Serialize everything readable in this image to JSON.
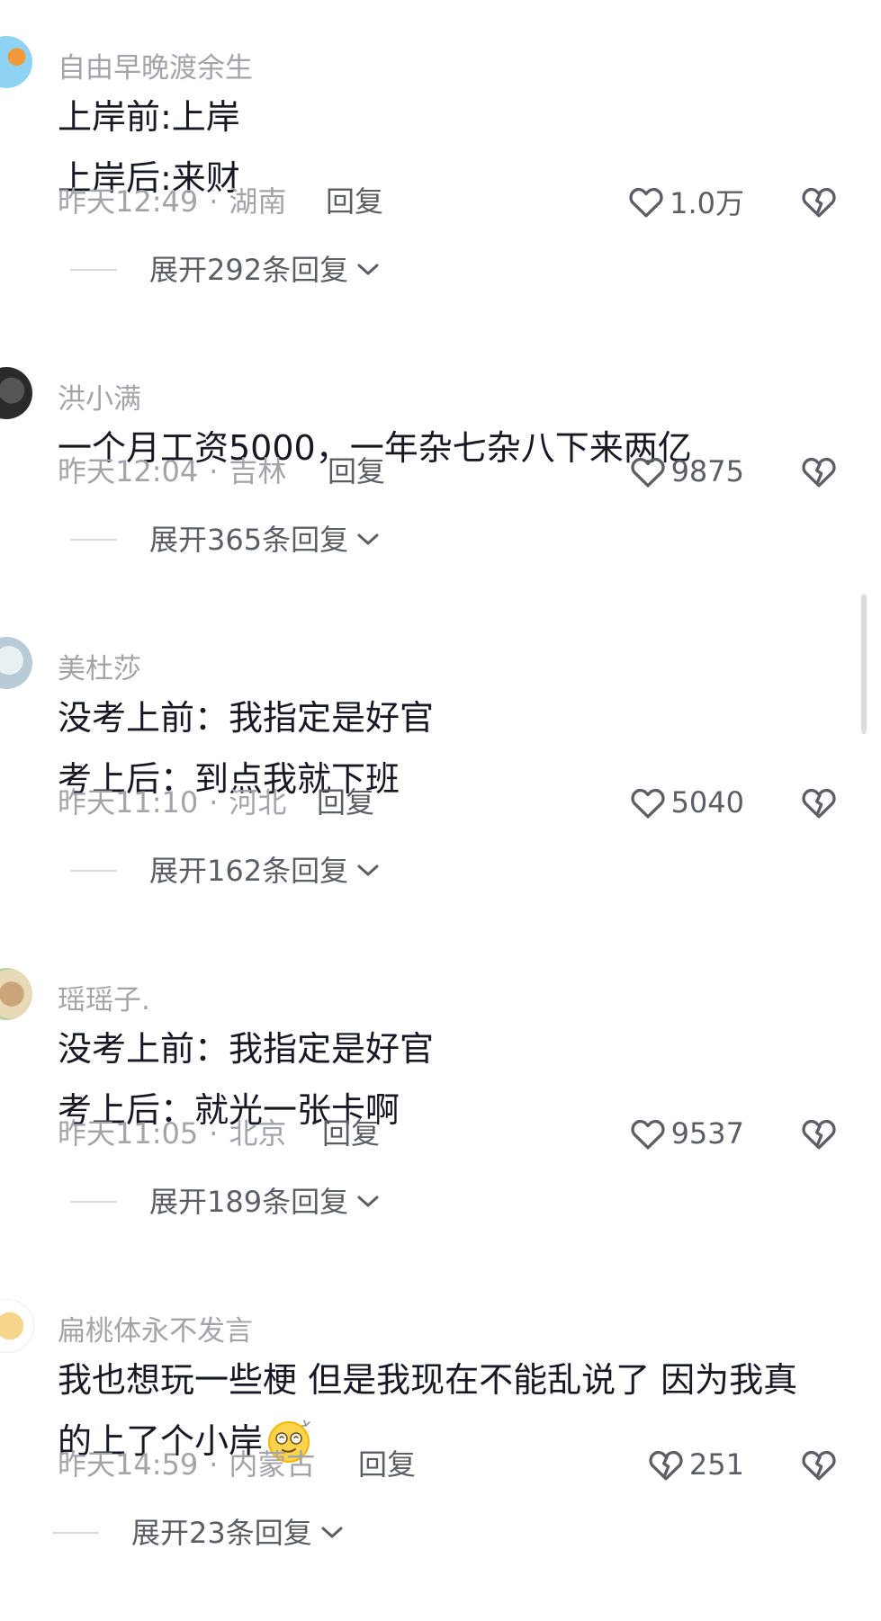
{
  "comments": [
    {
      "username": "自由早晚渡余生",
      "lines": [
        "上岸前:上岸",
        "上岸后:来财"
      ],
      "time": "昨天12:49",
      "location": "湖南",
      "reply": "回复",
      "likes": "1.0万",
      "expand": "展开292条回复"
    },
    {
      "username": "洪小满",
      "lines": [
        "一个月工资5000，一年杂七杂八下来两亿"
      ],
      "time": "昨天12:04",
      "location": "吉林",
      "reply": "回复",
      "likes": "9875",
      "expand": "展开365条回复"
    },
    {
      "username": "美杜莎",
      "lines": [
        "没考上前：我指定是好官",
        "考上后：到点我就下班"
      ],
      "time": "昨天11:10",
      "location": "河北",
      "reply": "回复",
      "likes": "5040",
      "expand": "展开162条回复"
    },
    {
      "username": "瑶瑶子.",
      "lines": [
        "没考上前：我指定是好官",
        "考上后：就光一张卡啊"
      ],
      "time": "昨天11:05",
      "location": "北京",
      "reply": "回复",
      "likes": "9537",
      "expand": "展开189条回复"
    },
    {
      "username": "扁桃体永不发言",
      "lines": [
        "我也想玩一些梗 但是我现在不能乱说了 因为我真",
        "的上了个小岸"
      ],
      "time": "昨天14:59",
      "location": "内蒙古",
      "reply": "回复",
      "likes": "251",
      "expand": "展开23条回复"
    }
  ],
  "separator": "·",
  "icons": {
    "like": "heart-outline-icon",
    "like_alt": "broken-heart-icon",
    "dislike": "broken-heart-icon",
    "expand": "chevron-down-icon",
    "emoji": "dizzy-smiley-emoji-icon"
  },
  "colors": {
    "text": "#161823",
    "secondary": "#a3a4aa",
    "action": "#5c5e66"
  }
}
